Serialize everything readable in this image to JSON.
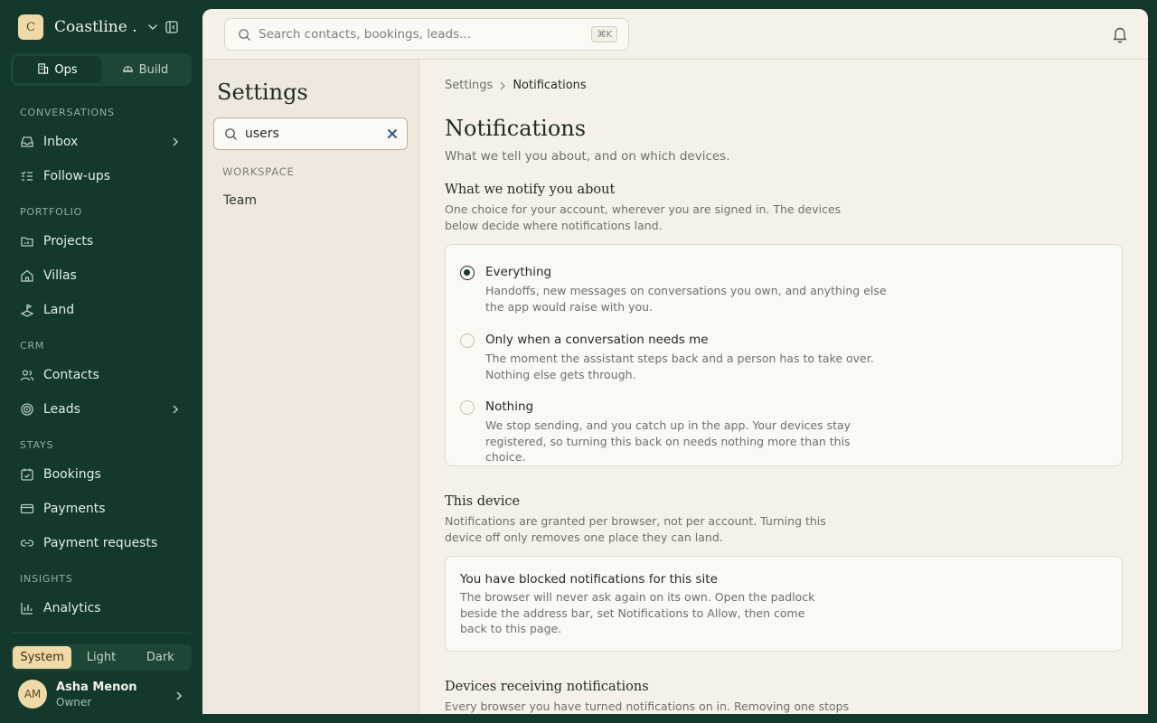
{
  "sidebar": {
    "workspace": {
      "initial": "C",
      "name": "Coastline ..."
    },
    "modes": [
      {
        "label": "Ops",
        "active": true
      },
      {
        "label": "Build",
        "active": false
      }
    ],
    "sections": [
      {
        "title": "CONVERSATIONS"
      },
      {
        "title": "PORTFOLIO"
      },
      {
        "title": "CRM"
      },
      {
        "title": "STAYS"
      },
      {
        "title": "INSIGHTS"
      }
    ],
    "items": [
      {
        "label": "Inbox",
        "icon": "inbox-icon",
        "has_children": true
      },
      {
        "label": "Follow-ups",
        "icon": "list-checks-icon"
      },
      {
        "label": "Projects",
        "icon": "folder-chart-icon"
      },
      {
        "label": "Villas",
        "icon": "house-icon"
      },
      {
        "label": "Land",
        "icon": "land-icon"
      },
      {
        "label": "Contacts",
        "icon": "users-icon"
      },
      {
        "label": "Leads",
        "icon": "target-icon",
        "has_children": true
      },
      {
        "label": "Bookings",
        "icon": "calendar-check-icon"
      },
      {
        "label": "Payments",
        "icon": "credit-card-icon"
      },
      {
        "label": "Payment requests",
        "icon": "link-icon"
      },
      {
        "label": "Analytics",
        "icon": "bar-chart-icon"
      }
    ],
    "theme": [
      {
        "label": "System",
        "active": true
      },
      {
        "label": "Light",
        "active": false
      },
      {
        "label": "Dark",
        "active": false
      }
    ],
    "user": {
      "initials": "AM",
      "name": "Asha Menon",
      "role": "Owner"
    }
  },
  "topbar": {
    "search_placeholder": "Search contacts, bookings, leads...",
    "search_shortcut": "⌘K"
  },
  "settings_nav": {
    "title": "Settings",
    "search_value": "users",
    "group": "WORKSPACE",
    "links": [
      "Team"
    ]
  },
  "content": {
    "breadcrumb": {
      "parent": "Settings",
      "current": "Notifications"
    },
    "title": "Notifications",
    "subtitle": "What we tell you about, and on which devices.",
    "notify_section": {
      "title": "What we notify you about",
      "description": "One choice for your account, wherever you are signed in. The devices below decide where notifications land.",
      "options": [
        {
          "label": "Everything",
          "description": "Handoffs, new messages on conversations you own, and anything else the app would raise with you.",
          "selected": true
        },
        {
          "label": "Only when a conversation needs me",
          "description": "The moment the assistant steps back and a person has to take over. Nothing else gets through.",
          "selected": false
        },
        {
          "label": "Nothing",
          "description": "We stop sending, and you catch up in the app. Your devices stay registered, so turning this back on needs nothing more than this choice.",
          "selected": false
        }
      ]
    },
    "device_section": {
      "title": "This device",
      "description": "Notifications are granted per browser, not per account. Turning this device off only removes one place they can land.",
      "notice_title": "You have blocked notifications for this site",
      "notice_description": "The browser will never ask again on its own. Open the padlock beside the address bar, set Notifications to Allow, then come back to this page."
    },
    "devices_section": {
      "title": "Devices receiving notifications",
      "description": "Every browser you have turned notifications on in. Removing one stops us"
    }
  },
  "colors": {
    "sidebar_bg": "#12392b",
    "panel_bg": "#f5f1e8",
    "accent_gold": "#efd9a7"
  }
}
